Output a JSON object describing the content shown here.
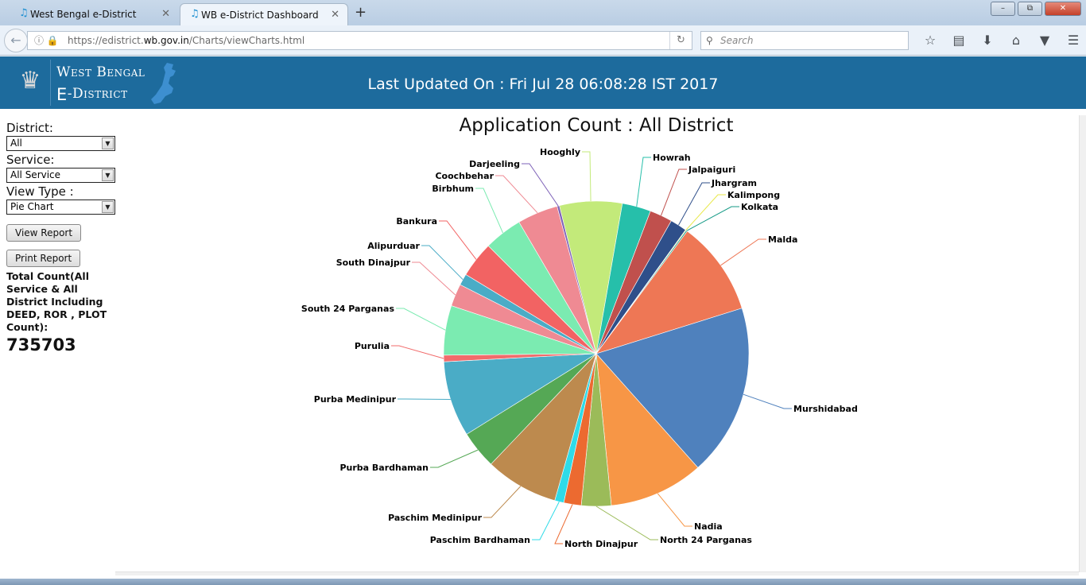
{
  "browser": {
    "tabs": [
      {
        "label": "West Bengal e-District",
        "active": false
      },
      {
        "label": "WB e-District Dashboard",
        "active": true
      }
    ],
    "new_tab_icon": "plus-icon",
    "url_prefix": "https://edistrict.",
    "url_host": "wb.gov.in",
    "url_path": "/Charts/viewCharts.html",
    "search_placeholder": "Search",
    "window_buttons": {
      "minimize": "–",
      "restore": "⧉",
      "close": "✕"
    }
  },
  "header": {
    "logo_top": "West Bengal",
    "logo_e": "e",
    "logo_bottom": "-District",
    "last_updated": "Last Updated On : Fri Jul 28 06:08:28 IST 2017"
  },
  "sidebar": {
    "district_label": "District:",
    "district_value": "All",
    "service_label": "Service:",
    "service_value": "All Service",
    "view_type_label": "View Type :",
    "view_type_value": "Pie Chart",
    "view_report": "View Report",
    "print_report": "Print Report",
    "total_label": "Total Count(All Service & All District Including DEED, ROR , PLOT Count):",
    "total_value": "735703"
  },
  "chart_data": {
    "type": "pie",
    "title": "Application Count : All District",
    "start_angle_deg": -14,
    "total": 735703,
    "slices": [
      {
        "name": "Hooghly",
        "value": 49050,
        "color": "#c3ea7a"
      },
      {
        "name": "Howrah",
        "value": 22480,
        "color": "#26bfaa"
      },
      {
        "name": "Jalpaiguri",
        "value": 17780,
        "color": "#c0504d"
      },
      {
        "name": "Jhargram",
        "value": 13080,
        "color": "#2f4f8a"
      },
      {
        "name": "Kalimpong",
        "value": 610,
        "color": "#e8e847"
      },
      {
        "name": "Kolkata",
        "value": 1020,
        "color": "#159a86"
      },
      {
        "name": "Malda",
        "value": 74140,
        "color": "#ee7755"
      },
      {
        "name": "Murshidabad",
        "value": 134900,
        "color": "#4f81bd"
      },
      {
        "name": "Nadia",
        "value": 74140,
        "color": "#f79646"
      },
      {
        "name": "North 24 Parganas",
        "value": 23300,
        "color": "#9bbb59"
      },
      {
        "name": "North Dinajpur",
        "value": 13690,
        "color": "#ec6a30"
      },
      {
        "name": "Paschim Bardhaman",
        "value": 7150,
        "color": "#2fdbe8"
      },
      {
        "name": "Paschim Medinipur",
        "value": 57220,
        "color": "#bd8a4e"
      },
      {
        "name": "Purba Bardhaman",
        "value": 29840,
        "color": "#55a855"
      },
      {
        "name": "Purba Medinipur",
        "value": 59260,
        "color": "#4aacc6"
      },
      {
        "name": "Purulia",
        "value": 5110,
        "color": "#f26b6b"
      },
      {
        "name": "South 24 Parganas",
        "value": 38830,
        "color": "#7bebb1"
      },
      {
        "name": "South Dinajpur",
        "value": 17580,
        "color": "#ef8a93"
      },
      {
        "name": "Alipurduar",
        "value": 8990,
        "color": "#4aacc6"
      },
      {
        "name": "Bankura",
        "value": 28200,
        "color": "#f26363"
      },
      {
        "name": "Birbhum",
        "value": 30040,
        "color": "#7bebb1"
      },
      {
        "name": "Coochbehar",
        "value": 31890,
        "color": "#ef8a93"
      },
      {
        "name": "Darjeeling",
        "value": 1843,
        "color": "#7e62b8"
      }
    ]
  }
}
